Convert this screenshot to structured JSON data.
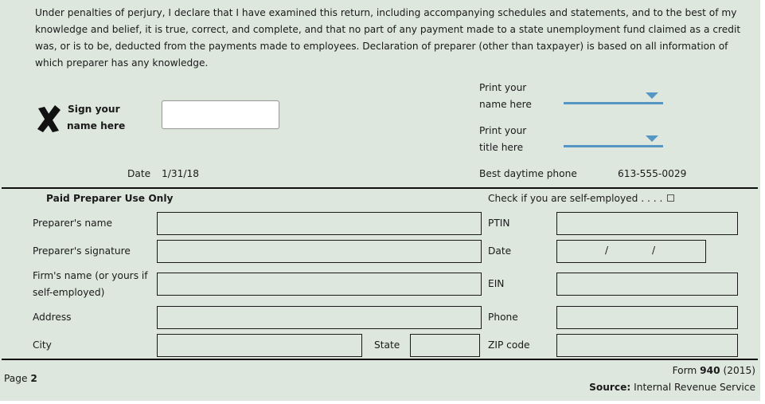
{
  "declaration": "Under penalties of perjury, I declare that I have examined this return, including accompanying schedules and statements, and to the best of my knowledge and belief, it is true, correct, and complete, and that no part of any payment made to a state unemployment fund claimed as a credit was, or is to be, deducted from the payments made to employees. Declaration of preparer (other than taxpayer) is based on all information of which preparer has any knowledge.",
  "signature": {
    "icon": "x-mark-icon",
    "label_line1": "Sign your",
    "label_line2": "name here",
    "value": ""
  },
  "print_name": {
    "label_line1": "Print your",
    "label_line2": "name here",
    "value": ""
  },
  "print_title": {
    "label_line1": "Print your",
    "label_line2": "title here",
    "value": ""
  },
  "date": {
    "label": "Date",
    "value": "1/31/18"
  },
  "phone": {
    "label": "Best daytime phone",
    "value": "613-555-0029"
  },
  "preparer": {
    "heading": "Paid Preparer Use Only",
    "self_employed_label": "Check if you are self-employed . . . .",
    "self_employed_checked": false,
    "fields_left": {
      "name": "Preparer's name",
      "signature": "Preparer's signature",
      "firm_line1": "Firm's name (or yours if",
      "firm_line2": "self-employed)",
      "address": "Address",
      "city": "City",
      "state": "State"
    },
    "fields_right": {
      "ptin": "PTIN",
      "date": "Date",
      "ein": "EIN",
      "phone": "Phone",
      "zip": "ZIP code"
    },
    "date_separators": [
      "/",
      "/"
    ]
  },
  "footer": {
    "page_prefix": "Page",
    "page_number": "2",
    "form_prefix": "Form",
    "form_number": "940",
    "form_year": "(2015)",
    "source_label": "Source:",
    "source_value": "Internal Revenue Service"
  },
  "colors": {
    "background": "#dde7de",
    "accent": "#5596c4"
  }
}
